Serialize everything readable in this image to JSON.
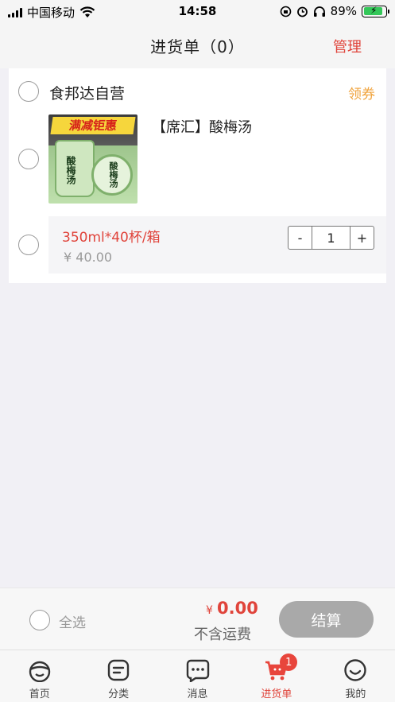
{
  "status_bar": {
    "carrier": "中国移动",
    "time": "14:58",
    "battery_percent": "89%"
  },
  "nav": {
    "title": "进货单（0）",
    "manage_label": "管理"
  },
  "shop": {
    "name": "食邦达自营",
    "coupon_label": "领券"
  },
  "product": {
    "title": "【席汇】酸梅汤",
    "image_banner": "满减钜惠",
    "image_text": "酸梅汤",
    "sku": {
      "spec": "350ml*40杯/箱",
      "price": "¥ 40.00",
      "quantity": "1",
      "minus_label": "-",
      "plus_label": "+"
    }
  },
  "checkout": {
    "select_all_label": "全选",
    "currency": "¥",
    "total": "0.00",
    "shipping_note": "不含运费",
    "checkout_label": "结算"
  },
  "tabs": [
    {
      "label": "首页",
      "icon": "home-face-icon"
    },
    {
      "label": "分类",
      "icon": "category-icon"
    },
    {
      "label": "消息",
      "icon": "message-icon"
    },
    {
      "label": "进货单",
      "icon": "cart-icon",
      "badge": "1",
      "active": true
    },
    {
      "label": "我的",
      "icon": "profile-smile-icon"
    }
  ],
  "colors": {
    "accent": "#e0443b",
    "coupon": "#f0a33c",
    "disabled_button": "#a9a9a9"
  }
}
